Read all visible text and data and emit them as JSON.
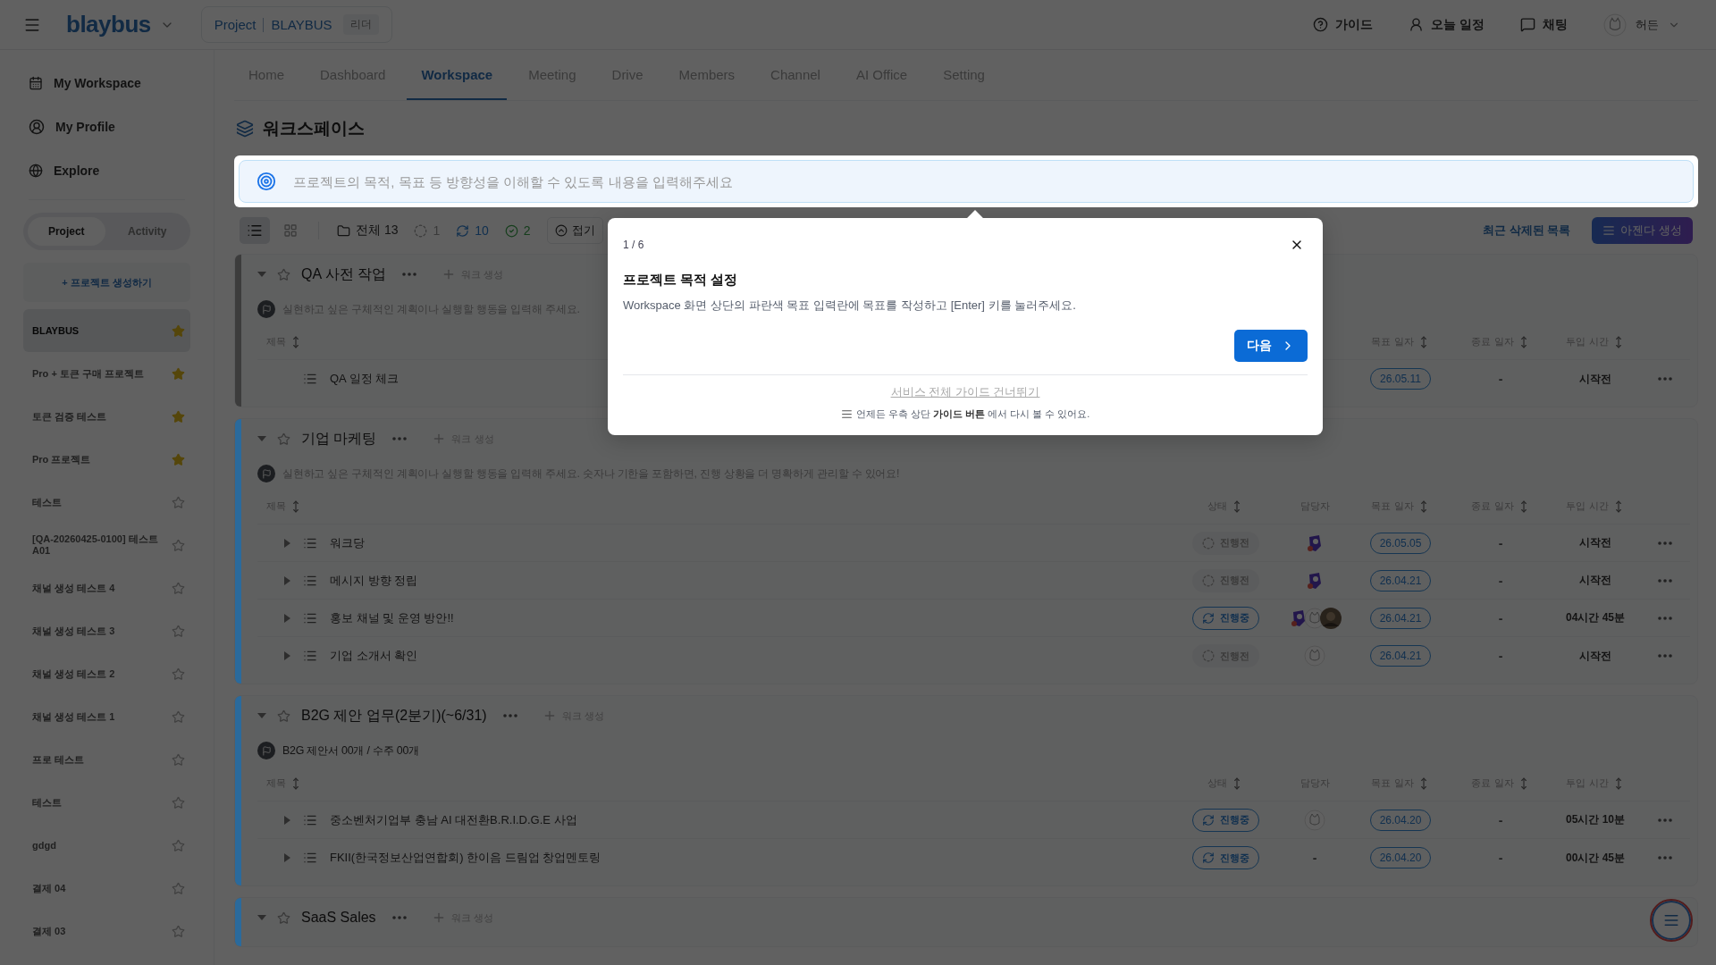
{
  "topbar": {
    "logo": "blaybus",
    "project_label": "Project",
    "project_name": "BLAYBUS",
    "role": "리더",
    "actions": [
      {
        "kind": "guide",
        "label": "가이드"
      },
      {
        "kind": "schedule",
        "label": "오늘 일정"
      },
      {
        "kind": "chat",
        "label": "채팅"
      }
    ],
    "user": {
      "name": "허든"
    }
  },
  "sidebar": {
    "nav": [
      {
        "kind": "workspace",
        "label": "My Workspace"
      },
      {
        "kind": "profile",
        "label": "My Profile"
      },
      {
        "kind": "explore",
        "label": "Explore"
      }
    ],
    "segments": [
      {
        "label": "Project",
        "selected": true
      },
      {
        "label": "Activity",
        "selected": false
      }
    ],
    "create_button": "+ 프로젝트 생성하기",
    "projects": [
      {
        "name": "BLAYBUS",
        "starred": true,
        "selected": true
      },
      {
        "name": "Pro + 토큰 구매 프로젝트",
        "starred": true,
        "selected": false
      },
      {
        "name": "토큰 검증 테스트",
        "starred": true,
        "selected": false
      },
      {
        "name": "Pro 프로젝트",
        "starred": true,
        "selected": false
      },
      {
        "name": "테스트",
        "starred": false,
        "selected": false
      },
      {
        "name": "[QA-20260425-0100] 테스트 A01",
        "starred": false,
        "selected": false
      },
      {
        "name": "채널 생성 테스트 4",
        "starred": false,
        "selected": false
      },
      {
        "name": "채널 생성 테스트 3",
        "starred": false,
        "selected": false
      },
      {
        "name": "채널 생성 테스트 2",
        "starred": false,
        "selected": false
      },
      {
        "name": "채널 생성 테스트 1",
        "starred": false,
        "selected": false
      },
      {
        "name": "프로 테스트",
        "starred": false,
        "selected": false
      },
      {
        "name": "테스트",
        "starred": false,
        "selected": false
      },
      {
        "name": "gdgd",
        "starred": false,
        "selected": false
      },
      {
        "name": "결제 04",
        "starred": false,
        "selected": false
      },
      {
        "name": "결제 03",
        "starred": false,
        "selected": false
      }
    ]
  },
  "tabs": [
    {
      "label": "Home",
      "selected": false
    },
    {
      "label": "Dashboard",
      "selected": false
    },
    {
      "label": "Workspace",
      "selected": true
    },
    {
      "label": "Meeting",
      "selected": false
    },
    {
      "label": "Drive",
      "selected": false
    },
    {
      "label": "Members",
      "selected": false
    },
    {
      "label": "Channel",
      "selected": false
    },
    {
      "label": "AI Office",
      "selected": false
    },
    {
      "label": "Setting",
      "selected": false
    }
  ],
  "page_title": "워크스페이스",
  "goal_input": {
    "placeholder": "프로젝트의 목적, 목표 등 방향성을 이해할 수 있도록 내용을 입력해주세요"
  },
  "toolbar": {
    "views": [
      {
        "kind": "list",
        "selected": true
      },
      {
        "kind": "grid",
        "selected": false
      }
    ],
    "filters": [
      {
        "kind": "all",
        "label": "전체 13"
      },
      {
        "kind": "todo",
        "label": "1"
      },
      {
        "kind": "doing",
        "label": "10"
      },
      {
        "kind": "done",
        "label": "2"
      }
    ],
    "collapse": "접기",
    "trash_link": "최근 삭제된 목록",
    "agenda_button": "아젠다 생성"
  },
  "sections": [
    {
      "title": "QA 사전 작업",
      "color": "#3c3c3c",
      "expanded": true,
      "starred": false,
      "add_button": "워크 생성",
      "placeholder": "실현하고 싶은 구체적인 계획이나 실행할 행동을 입력해 주세요.",
      "columns": [
        {
          "kind": "title",
          "label": "제목",
          "sortable": true
        },
        {
          "kind": "due",
          "label": "목표 일자",
          "sortable": true
        },
        {
          "kind": "end",
          "label": "종료 일자",
          "sortable": true
        },
        {
          "kind": "time",
          "label": "투입 시간",
          "sortable": true
        }
      ],
      "rows": [
        {
          "title": "QA 일정 체크",
          "expandable": false,
          "due": "26.05.11",
          "end": "-",
          "time": "시작전"
        }
      ]
    },
    {
      "title": "기업 마케팅",
      "color": "#2a6a9c",
      "expanded": true,
      "starred": false,
      "add_button": "워크 생성",
      "placeholder": "실현하고 싶은 구체적인 계획이나 실행할 행동을 입력해 주세요. 숫자나 기한을 포함하면, 진행 상황을 더 명확하게 관리할 수 있어요!",
      "columns": [
        {
          "kind": "title",
          "label": "제목",
          "sortable": true
        },
        {
          "kind": "status",
          "label": "상태",
          "sortable": true
        },
        {
          "kind": "assignee",
          "label": "담당자",
          "sortable": false
        },
        {
          "kind": "due",
          "label": "목표 일자",
          "sortable": true
        },
        {
          "kind": "end",
          "label": "종료 일자",
          "sortable": true
        },
        {
          "kind": "time",
          "label": "투입 시간",
          "sortable": true
        }
      ],
      "rows": [
        {
          "title": "워크당",
          "expandable": true,
          "status": {
            "kind": "todo",
            "label": "진행전"
          },
          "assignees": [
            {
              "kind": "mascot"
            }
          ],
          "due": "26.05.05",
          "end": "-",
          "time": "시작전"
        },
        {
          "title": "메시지 방향 정립",
          "expandable": true,
          "status": {
            "kind": "todo",
            "label": "진행전"
          },
          "assignees": [
            {
              "kind": "mascot"
            }
          ],
          "due": "26.04.21",
          "end": "-",
          "time": "시작전"
        },
        {
          "title": "홍보 채널 및 운영 방안!!",
          "expandable": true,
          "status": {
            "kind": "doing",
            "label": "진행중"
          },
          "assignees": [
            {
              "kind": "mascot"
            },
            {
              "kind": "sketch"
            },
            {
              "kind": "photo"
            }
          ],
          "due": "26.04.21",
          "end": "-",
          "time": "04시간 45분"
        },
        {
          "title": "기업 소개서 확인",
          "expandable": true,
          "status": {
            "kind": "todo",
            "label": "진행전"
          },
          "assignees": [
            {
              "kind": "sketch"
            }
          ],
          "due": "26.04.21",
          "end": "-",
          "time": "시작전"
        }
      ]
    },
    {
      "title": "B2G 제안 업무(2분기)(~6/31)",
      "color": "#2a6a9c",
      "expanded": true,
      "starred": false,
      "add_button": "워크 생성",
      "description": "B2G 제안서 00개 / 수주 00개",
      "columns": [
        {
          "kind": "title",
          "label": "제목",
          "sortable": true
        },
        {
          "kind": "status",
          "label": "상태",
          "sortable": true
        },
        {
          "kind": "assignee",
          "label": "담당자",
          "sortable": false
        },
        {
          "kind": "due",
          "label": "목표 일자",
          "sortable": true
        },
        {
          "kind": "end",
          "label": "종료 일자",
          "sortable": true
        },
        {
          "kind": "time",
          "label": "투입 시간",
          "sortable": true
        }
      ],
      "rows": [
        {
          "title": "중소벤처기업부 충남 AI 대전환B.R.I.D.G.E 사업",
          "expandable": true,
          "status": {
            "kind": "doing",
            "label": "진행중"
          },
          "assignees": [
            {
              "kind": "sketch"
            }
          ],
          "due": "26.04.20",
          "end": "-",
          "time": "05시간 10분"
        },
        {
          "title": "FKII(한국정보산업연합회) 한이음 드림업 창업멘토링",
          "expandable": true,
          "status": {
            "kind": "doing",
            "label": "진행중"
          },
          "assignee_empty": "-",
          "due": "26.04.20",
          "end": "-",
          "time": "00시간 45분"
        }
      ]
    },
    {
      "title": "SaaS Sales",
      "color": "#2a6a9c",
      "expanded": true,
      "starred": false,
      "add_button": "워크 생성"
    }
  ],
  "guide_popover": {
    "step": "1 / 6",
    "title": "프로젝트 목적 설정",
    "body": "Workspace 화면 상단의 파란색 목표 입력란에 목표를 작성하고 [Enter] 키를 눌러주세요.",
    "next_button": "다음",
    "skip_link": "서비스 전체 가이드 건너뛰기",
    "footnote": "언제든 우측 상단 **가이드 버튼** 에서 다시 볼 수 있어요."
  }
}
